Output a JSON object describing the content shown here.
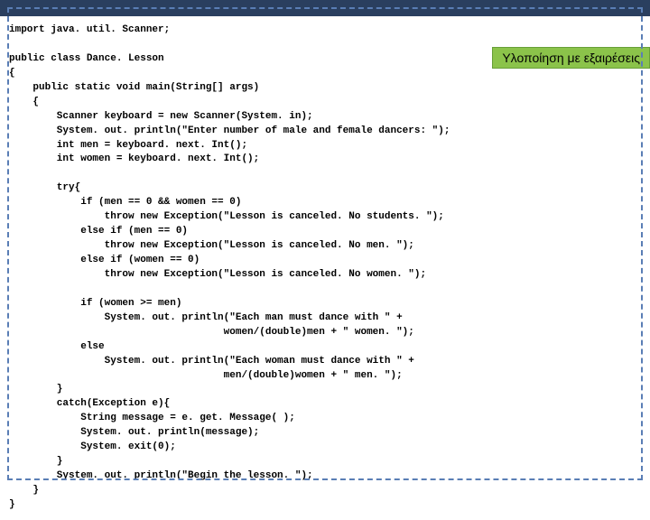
{
  "badge": {
    "label": "Υλοποίηση με εξαιρέσεις"
  },
  "code": {
    "l1": "import java. util. Scanner;",
    "l2": "",
    "l3": "public class Dance. Lesson",
    "l4": "{",
    "l5": "    public static void main(String[] args)",
    "l6": "    {",
    "l7": "        Scanner keyboard = new Scanner(System. in);",
    "l8": "        System. out. println(\"Enter number of male and female dancers: \");",
    "l9": "        int men = keyboard. next. Int();",
    "l10": "        int women = keyboard. next. Int();",
    "l11": "",
    "l12": "        try{",
    "l13": "            if (men == 0 && women == 0)",
    "l14": "                throw new Exception(\"Lesson is canceled. No students. \");",
    "l15": "            else if (men == 0)",
    "l16": "                throw new Exception(\"Lesson is canceled. No men. \");",
    "l17": "            else if (women == 0)",
    "l18": "                throw new Exception(\"Lesson is canceled. No women. \");",
    "l19": "",
    "l20": "            if (women >= men)",
    "l21": "                System. out. println(\"Each man must dance with \" +",
    "l22": "                                    women/(double)men + \" women. \");",
    "l23": "            else",
    "l24": "                System. out. println(\"Each woman must dance with \" +",
    "l25": "                                    men/(double)women + \" men. \");",
    "l26": "        }",
    "l27": "        catch(Exception e){",
    "l28": "            String message = e. get. Message( );",
    "l29": "            System. out. println(message);",
    "l30": "            System. exit(0);",
    "l31": "        }",
    "l32": "        System. out. println(\"Begin the lesson. \");",
    "l33": "    }",
    "l34": "}"
  }
}
